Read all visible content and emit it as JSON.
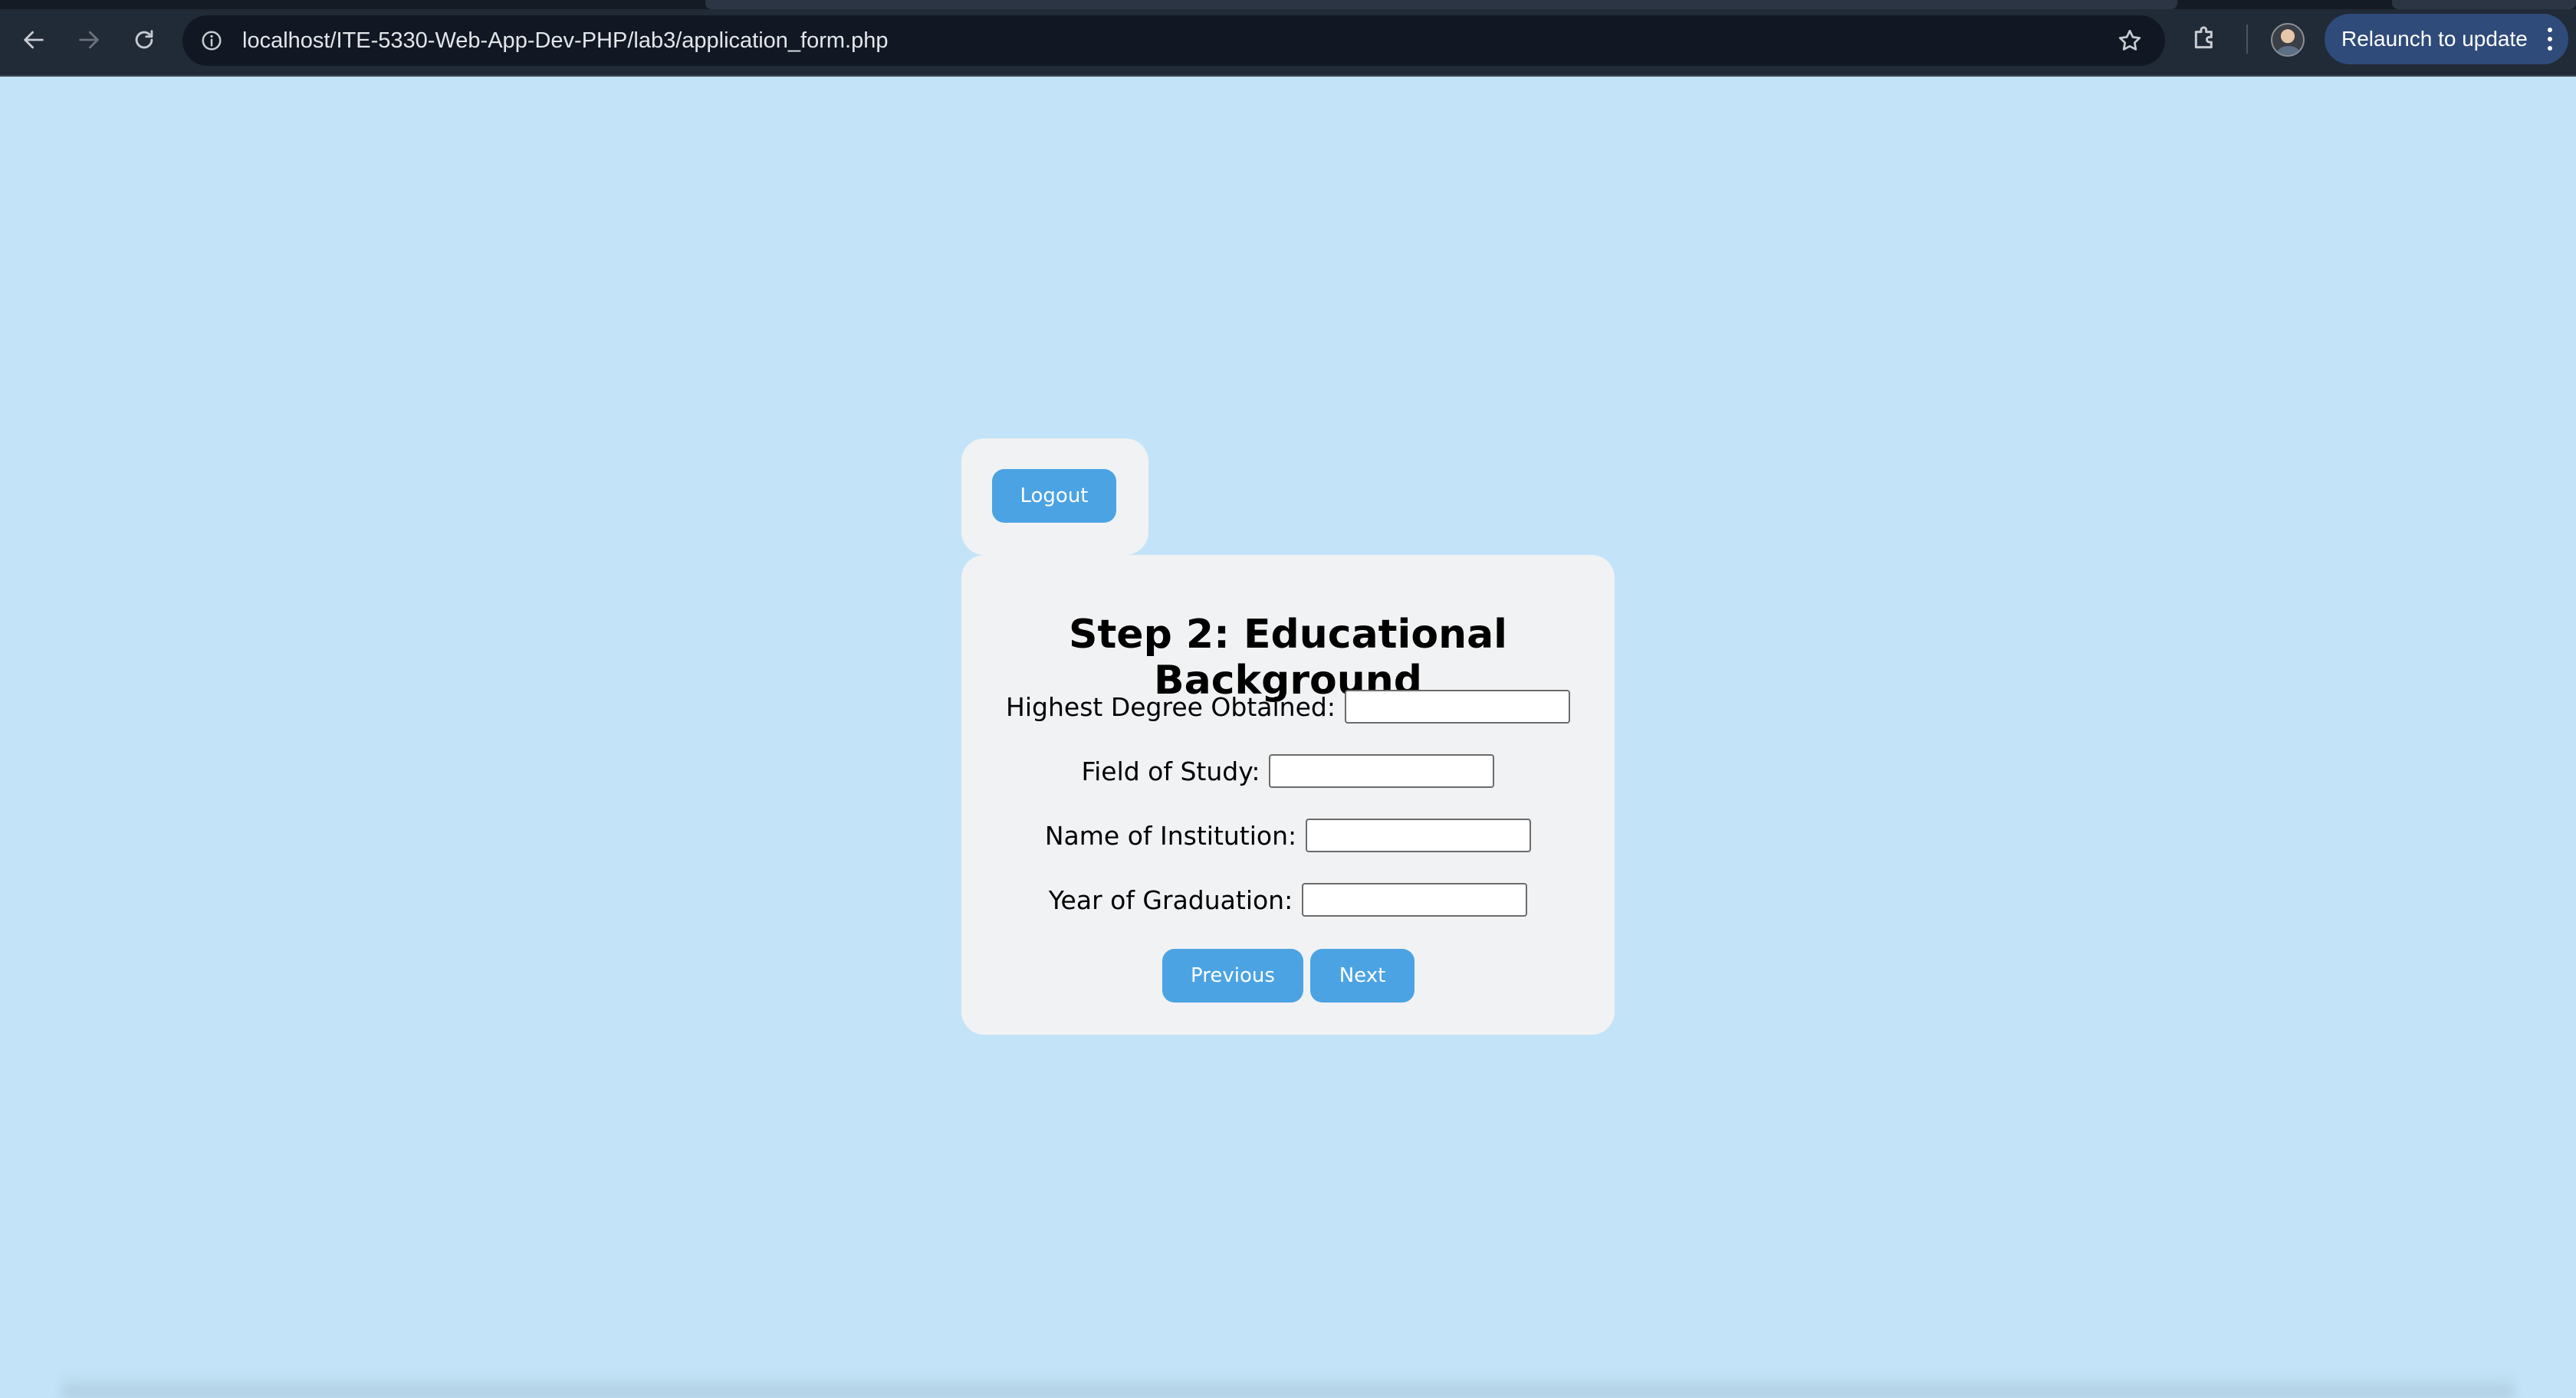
{
  "browser": {
    "url": "localhost/ITE-5330-Web-App-Dev-PHP/lab3/application_form.php",
    "relaunch_label": "Relaunch to update",
    "icons": [
      "back-arrow-icon",
      "forward-arrow-icon",
      "reload-icon",
      "site-info-icon",
      "bookmark-star-icon",
      "extensions-icon",
      "profile-avatar",
      "more-menu-icon"
    ]
  },
  "page": {
    "logout_label": "Logout",
    "title": "Step 2: Educational Background",
    "fields": [
      {
        "label": "Highest Degree Obtained:",
        "value": ""
      },
      {
        "label": "Field of Study:",
        "value": ""
      },
      {
        "label": "Name of Institution:",
        "value": ""
      },
      {
        "label": "Year of Graduation:",
        "value": ""
      }
    ],
    "previous_label": "Previous",
    "next_label": "Next"
  },
  "colors": {
    "page_background": "#c3e4f8",
    "card_background": "#f1f2f4",
    "button": "#4ba3e3",
    "browser_bar": "#212a37",
    "relaunch_button": "#2f4b7a"
  }
}
